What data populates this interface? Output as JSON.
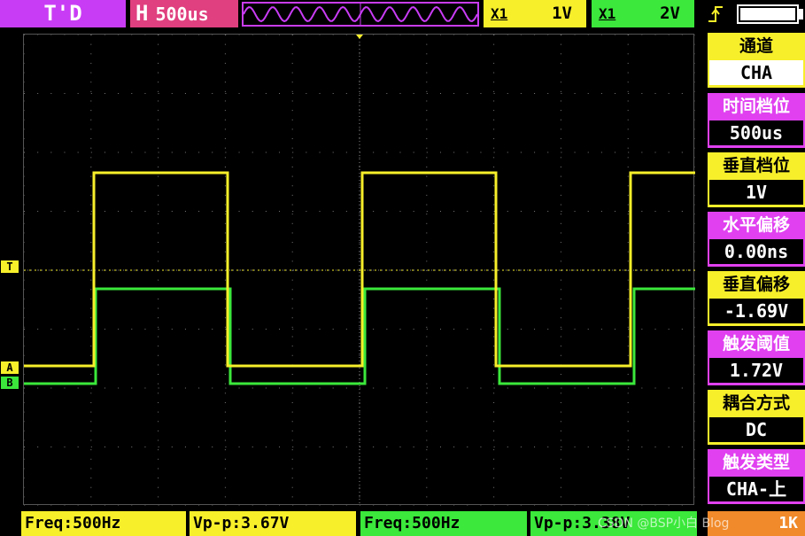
{
  "top_bar": {
    "mode": "T'D",
    "timebase_label": "H",
    "timebase_value": "500us",
    "ch1_coupling": "X1",
    "ch1_volts": "1V",
    "ch2_coupling": "X1",
    "ch2_volts": "2V",
    "trigger_icon": "trigger-rising-edge-icon",
    "battery_icon": "battery-full-icon",
    "battery_level": 1.0
  },
  "menu": [
    {
      "title": "通道",
      "value": "CHA",
      "title_color": "#f7ef2a",
      "selected": true
    },
    {
      "title": "时间档位",
      "value": "500us",
      "title_color": "#e040f0",
      "selected": false
    },
    {
      "title": "垂直档位",
      "value": "1V",
      "title_color": "#f7ef2a",
      "selected": false
    },
    {
      "title": "水平偏移",
      "value": "0.00ns",
      "title_color": "#e040f0",
      "selected": false
    },
    {
      "title": "垂直偏移",
      "value": "-1.69V",
      "title_color": "#f7ef2a",
      "selected": false
    },
    {
      "title": "触发阈值",
      "value": "1.72V",
      "title_color": "#e040f0",
      "selected": false
    },
    {
      "title": "耦合方式",
      "value": "DC",
      "title_color": "#f7ef2a",
      "selected": false
    },
    {
      "title": "触发类型",
      "value": "CHA-上",
      "title_color": "#e040f0",
      "selected": false
    }
  ],
  "markers": {
    "trigger": "T",
    "ch_a": "A",
    "ch_b": "B"
  },
  "bottom": {
    "a_freq": "Freq:500Hz",
    "a_vpp": "Vp-p:3.67V",
    "b_freq": "Freq:500Hz",
    "b_vpp": "Vp-p:3.38V",
    "extra": "1K"
  },
  "watermark": "CSDN @BSP小白 Blog",
  "colors": {
    "ch_a": "#f7ef2a",
    "ch_b": "#3be83b",
    "accent": "#c93cf5",
    "timebase": "#e0407f"
  }
}
